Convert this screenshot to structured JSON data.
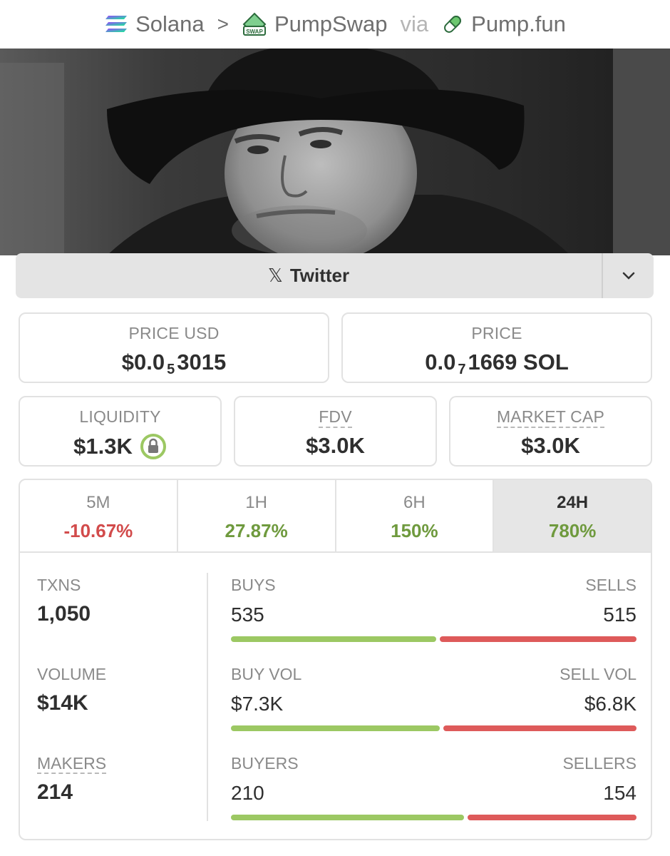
{
  "breadcrumb": {
    "chain": "Solana",
    "dex": "PumpSwap",
    "via": "via",
    "launchpad": "Pump.fun",
    "dex_badge": "SWAP"
  },
  "twitter": {
    "label": "Twitter"
  },
  "price_usd": {
    "label": "PRICE USD",
    "prefix": "$0.0",
    "subscript": "5",
    "digits": "3015"
  },
  "price_sol": {
    "label": "PRICE",
    "prefix": "0.0",
    "subscript": "7",
    "digits": "1669 SOL"
  },
  "liquidity": {
    "label": "LIQUIDITY",
    "value": "$1.3K"
  },
  "fdv": {
    "label": "FDV",
    "value": "$3.0K"
  },
  "market_cap": {
    "label": "MARKET CAP",
    "value": "$3.0K"
  },
  "timeframes": [
    {
      "label": "5M",
      "change": "-10.67%"
    },
    {
      "label": "1H",
      "change": "27.87%"
    },
    {
      "label": "6H",
      "change": "150%"
    },
    {
      "label": "24H",
      "change": "780%"
    }
  ],
  "active_timeframe": "24H",
  "txns": {
    "label": "TXNS",
    "value": "1,050"
  },
  "volume": {
    "label": "VOLUME",
    "value": "$14K"
  },
  "makers": {
    "label": "MAKERS",
    "value": "214"
  },
  "buys_sells": {
    "left_label": "BUYS",
    "left_value": "535",
    "right_label": "SELLS",
    "right_value": "515",
    "buy_fraction": 0.51
  },
  "vol_split": {
    "left_label": "BUY VOL",
    "left_value": "$7.3K",
    "right_label": "SELL VOL",
    "right_value": "$6.8K",
    "buy_fraction": 0.52
  },
  "buyers_sellers": {
    "left_label": "BUYERS",
    "left_value": "210",
    "right_label": "SELLERS",
    "right_value": "154",
    "buy_fraction": 0.58
  },
  "colors": {
    "positive": "#6f9a3e",
    "negative": "#d24b4b",
    "buy_bar": "#9cc863",
    "sell_bar": "#de5a5a"
  }
}
